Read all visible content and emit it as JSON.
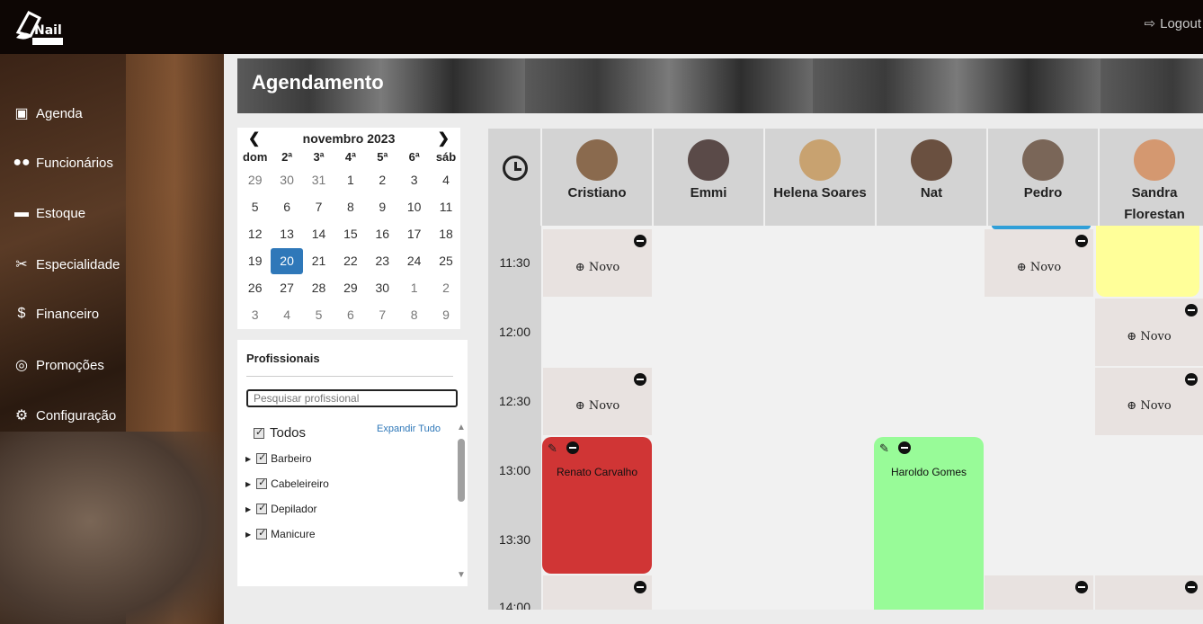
{
  "header": {
    "logout_label": "Logout",
    "logo_alt": "Nail"
  },
  "sidebar": {
    "items": [
      {
        "label": "Agenda",
        "icon": "address-book-icon"
      },
      {
        "label": "Funcionários",
        "icon": "users-icon"
      },
      {
        "label": "Estoque",
        "icon": "archive-icon"
      },
      {
        "label": "Especialidade",
        "icon": "scissors-icon"
      },
      {
        "label": "Financeiro",
        "icon": "dollar-icon"
      },
      {
        "label": "Promoções",
        "icon": "whatsapp-icon"
      },
      {
        "label": "Configuração",
        "icon": "cogs-icon"
      }
    ]
  },
  "page": {
    "title": "Agendamento"
  },
  "calendar": {
    "month_label": "novembro 2023",
    "weekdays": [
      "dom",
      "2ª",
      "3ª",
      "4ª",
      "5ª",
      "6ª",
      "sáb"
    ],
    "weeks": [
      [
        "29",
        "30",
        "31",
        "1",
        "2",
        "3",
        "4"
      ],
      [
        "5",
        "6",
        "7",
        "8",
        "9",
        "10",
        "11"
      ],
      [
        "12",
        "13",
        "14",
        "15",
        "16",
        "17",
        "18"
      ],
      [
        "19",
        "20",
        "21",
        "22",
        "23",
        "24",
        "25"
      ],
      [
        "26",
        "27",
        "28",
        "29",
        "30",
        "1",
        "2"
      ],
      [
        "3",
        "4",
        "5",
        "6",
        "7",
        "8",
        "9"
      ]
    ],
    "selected_day": "20"
  },
  "professionals_panel": {
    "title": "Profissionais",
    "search_placeholder": "Pesquisar profissional",
    "all_label": "Todos",
    "expand_label": "Expandir Tudo",
    "groups": [
      "Barbeiro",
      "Cabeleireiro",
      "Depilador",
      "Manicure"
    ]
  },
  "schedule": {
    "professionals": [
      {
        "name": "Cristiano",
        "avatar_color": "#8a6a4e"
      },
      {
        "name": "Emmi",
        "avatar_color": "#5a4a48"
      },
      {
        "name": "Helena Soares",
        "avatar_color": "#c8a270"
      },
      {
        "name": "Nat",
        "avatar_color": "#6a5040"
      },
      {
        "name": "Pedro",
        "avatar_color": "#7a6658"
      },
      {
        "name": "Sandra Florestan",
        "avatar_color": "#d49870"
      }
    ],
    "times": [
      "11:30",
      "12:00",
      "12:30",
      "13:00",
      "13:30",
      "14:00"
    ],
    "new_label": "Novo",
    "appointments": [
      {
        "client": "Renato Carvalho",
        "color": "#d03535"
      },
      {
        "client": "Haroldo Gomes",
        "color": "#98fb98"
      }
    ],
    "highlight_color": "#ffff99"
  }
}
